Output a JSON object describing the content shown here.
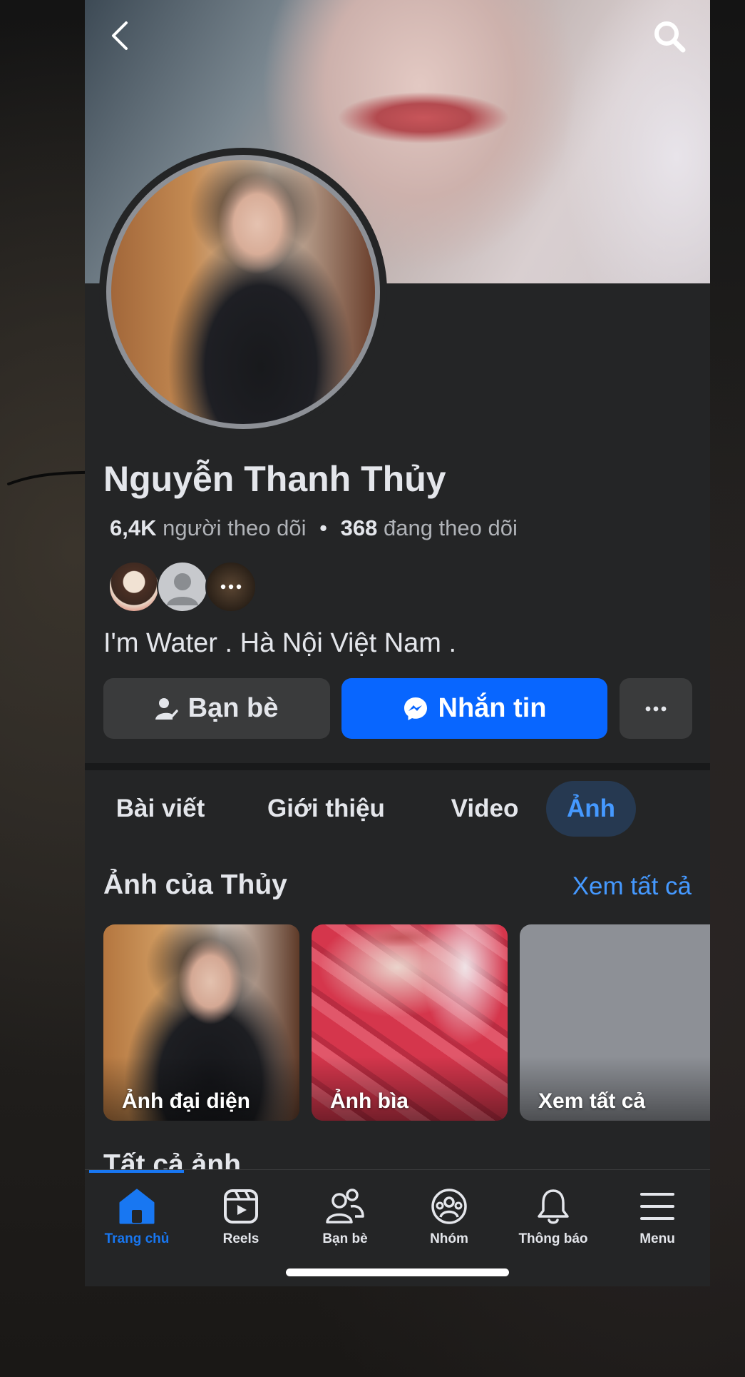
{
  "profile": {
    "name": "Nguyễn Thanh Thủy",
    "followers_count": "6,4K",
    "followers_label": "người theo dõi",
    "separator": "•",
    "following_count": "368",
    "following_label": "đang theo dõi",
    "bio": "I'm Water . Hà Nội Việt Nam ."
  },
  "actions": {
    "friends_label": "Bạn bè",
    "message_label": "Nhắn tin",
    "more_icon": "more-dots-icon"
  },
  "tabs": [
    {
      "label": "Bài viết",
      "active": false
    },
    {
      "label": "Giới thiệu",
      "active": false
    },
    {
      "label": "Video",
      "active": false
    },
    {
      "label": "Ảnh",
      "active": true
    }
  ],
  "photos_section": {
    "title": "Ảnh của Thủy",
    "see_all": "Xem tất cả",
    "albums": [
      {
        "label": "Ảnh đại diện"
      },
      {
        "label": "Ảnh bìa"
      },
      {
        "label": "Xem tất cả"
      }
    ],
    "next_section_title": "Tất cả ảnh"
  },
  "bottom_nav": [
    {
      "label": "Trang chủ",
      "icon": "home-icon",
      "active": true
    },
    {
      "label": "Reels",
      "icon": "reels-icon",
      "active": false
    },
    {
      "label": "Bạn bè",
      "icon": "friends-icon",
      "active": false
    },
    {
      "label": "Nhóm",
      "icon": "groups-icon",
      "active": false
    },
    {
      "label": "Thông báo",
      "icon": "bell-icon",
      "active": false
    },
    {
      "label": "Menu",
      "icon": "menu-icon",
      "active": false
    }
  ],
  "colors": {
    "background": "#242526",
    "accent_blue": "#0866ff",
    "link_blue": "#4599ff",
    "active_tab_bg": "#263951",
    "secondary_button": "#3a3b3c"
  }
}
